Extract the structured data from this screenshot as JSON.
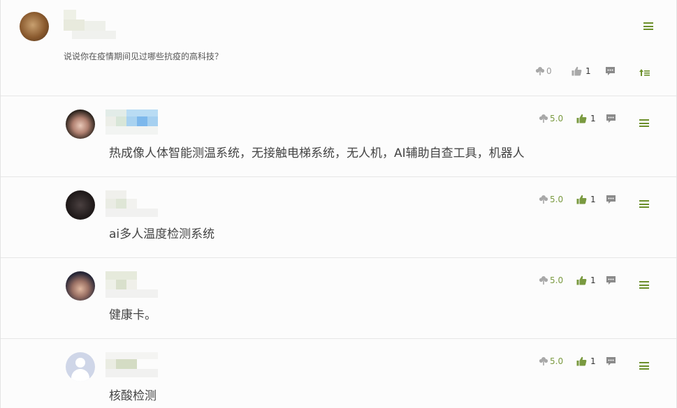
{
  "question": {
    "text": "说说你在疫情期间见过哪些抗疫的高科技？",
    "score": "0",
    "likes": "1",
    "icons": {
      "score": "flower-icon",
      "like": "thumbs-up-icon",
      "comment": "comment-icon",
      "menu": "menu-icon",
      "sort": "sort-icon"
    }
  },
  "answers": [
    {
      "text": "热成像人体智能测温系统，无接触电梯系统，无人机，AI辅助自查工具，机器人",
      "score": "5.0",
      "likes": "1"
    },
    {
      "text": "ai多人温度检测系统",
      "score": "5.0",
      "likes": "1"
    },
    {
      "text": "健康卡。",
      "score": "5.0",
      "likes": "1"
    },
    {
      "text": "核酸检测",
      "score": "5.0",
      "likes": "1"
    }
  ],
  "colors": {
    "accent": "#6b8f2a",
    "like_active": "#7a9a40",
    "muted": "#9a9a9a",
    "border": "#e6e6e6"
  }
}
